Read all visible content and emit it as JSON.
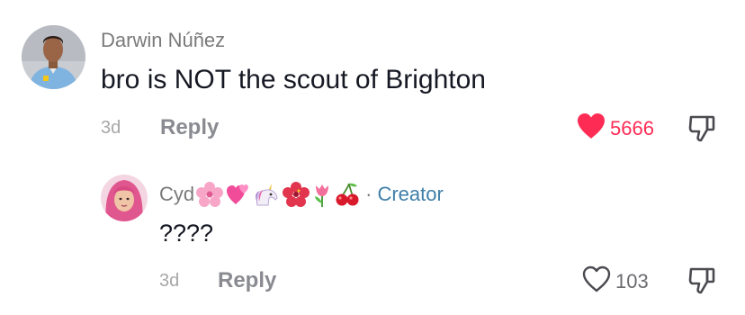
{
  "comments": [
    {
      "username": "Darwin Núñez",
      "text": "bro is NOT the scout of Brighton",
      "time": "3d",
      "reply_label": "Reply",
      "like_count": "5666",
      "liked": true
    },
    {
      "username": "Cyd",
      "creator_label": "Creator",
      "creator_separator": "·",
      "text": "????",
      "time": "3d",
      "reply_label": "Reply",
      "like_count": "103",
      "liked": false
    }
  ],
  "colors": {
    "like_active": "#fe2c55",
    "text_primary": "#161823",
    "text_secondary": "#8a8b91",
    "creator": "#3f7fa8"
  },
  "icons": {
    "like": "heart-icon",
    "dislike": "thumbs-down-icon",
    "emojis": [
      "cherry-blossom-icon",
      "sparkling-heart-icon",
      "unicorn-icon",
      "hibiscus-icon",
      "tulip-icon",
      "cherries-icon"
    ]
  }
}
